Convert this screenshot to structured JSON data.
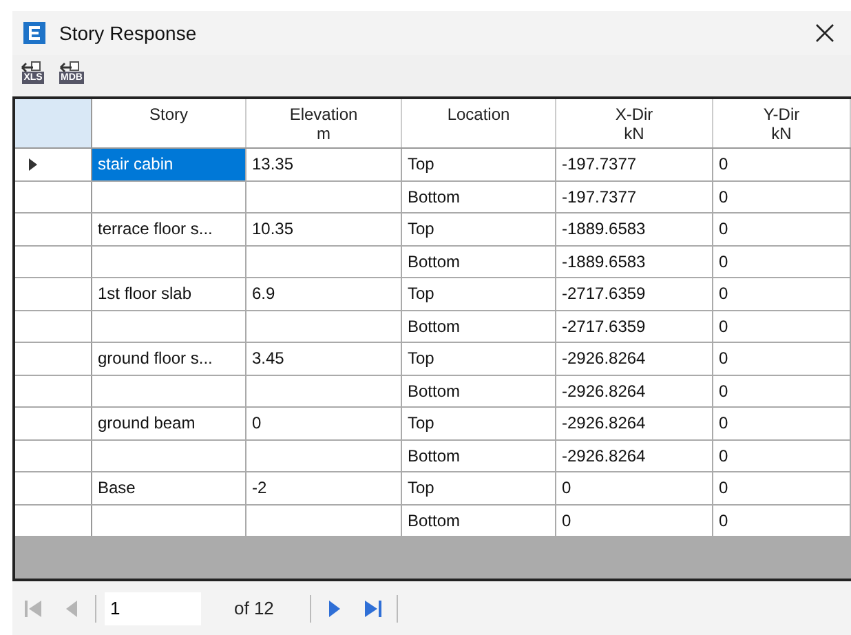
{
  "window": {
    "title": "Story Response"
  },
  "toolbar": [
    {
      "label": "XLS"
    },
    {
      "label": "MDB"
    }
  ],
  "table": {
    "columns": [
      {
        "label": "Story"
      },
      {
        "label": "Elevation",
        "unit": "m"
      },
      {
        "label": "Location"
      },
      {
        "label": "X-Dir",
        "unit": "kN"
      },
      {
        "label": "Y-Dir",
        "unit": "kN"
      }
    ],
    "rows": [
      {
        "current": true,
        "selected": true,
        "story": "stair cabin",
        "elevation": "13.35",
        "location": "Top",
        "x_dir": "-197.7377",
        "y_dir": "0"
      },
      {
        "current": false,
        "selected": false,
        "location": "Bottom",
        "x_dir": "-197.7377",
        "y_dir": "0"
      },
      {
        "current": false,
        "selected": false,
        "story": "terrace floor s...",
        "elevation": "10.35",
        "location": "Top",
        "x_dir": "-1889.6583",
        "y_dir": "0"
      },
      {
        "current": false,
        "selected": false,
        "location": "Bottom",
        "x_dir": "-1889.6583",
        "y_dir": "0"
      },
      {
        "current": false,
        "selected": false,
        "story": "1st floor slab",
        "elevation": "6.9",
        "location": "Top",
        "x_dir": "-2717.6359",
        "y_dir": "0"
      },
      {
        "current": false,
        "selected": false,
        "location": "Bottom",
        "x_dir": "-2717.6359",
        "y_dir": "0"
      },
      {
        "current": false,
        "selected": false,
        "story": "ground floor s...",
        "elevation": "3.45",
        "location": "Top",
        "x_dir": "-2926.8264",
        "y_dir": "0"
      },
      {
        "current": false,
        "selected": false,
        "location": "Bottom",
        "x_dir": "-2926.8264",
        "y_dir": "0"
      },
      {
        "current": false,
        "selected": false,
        "story": "ground beam",
        "elevation": "0",
        "location": "Top",
        "x_dir": "-2926.8264",
        "y_dir": "0"
      },
      {
        "current": false,
        "selected": false,
        "location": "Bottom",
        "x_dir": "-2926.8264",
        "y_dir": "0"
      },
      {
        "current": false,
        "selected": false,
        "story": "Base",
        "elevation": "-2",
        "location": "Top",
        "x_dir": "0",
        "y_dir": "0"
      },
      {
        "current": false,
        "selected": false,
        "location": "Bottom",
        "x_dir": "0",
        "y_dir": "0"
      }
    ]
  },
  "navigator": {
    "first_disabled": true,
    "prev_disabled": true,
    "page": "1",
    "of_text": "of 12",
    "next_disabled": false,
    "last_disabled": false
  }
}
